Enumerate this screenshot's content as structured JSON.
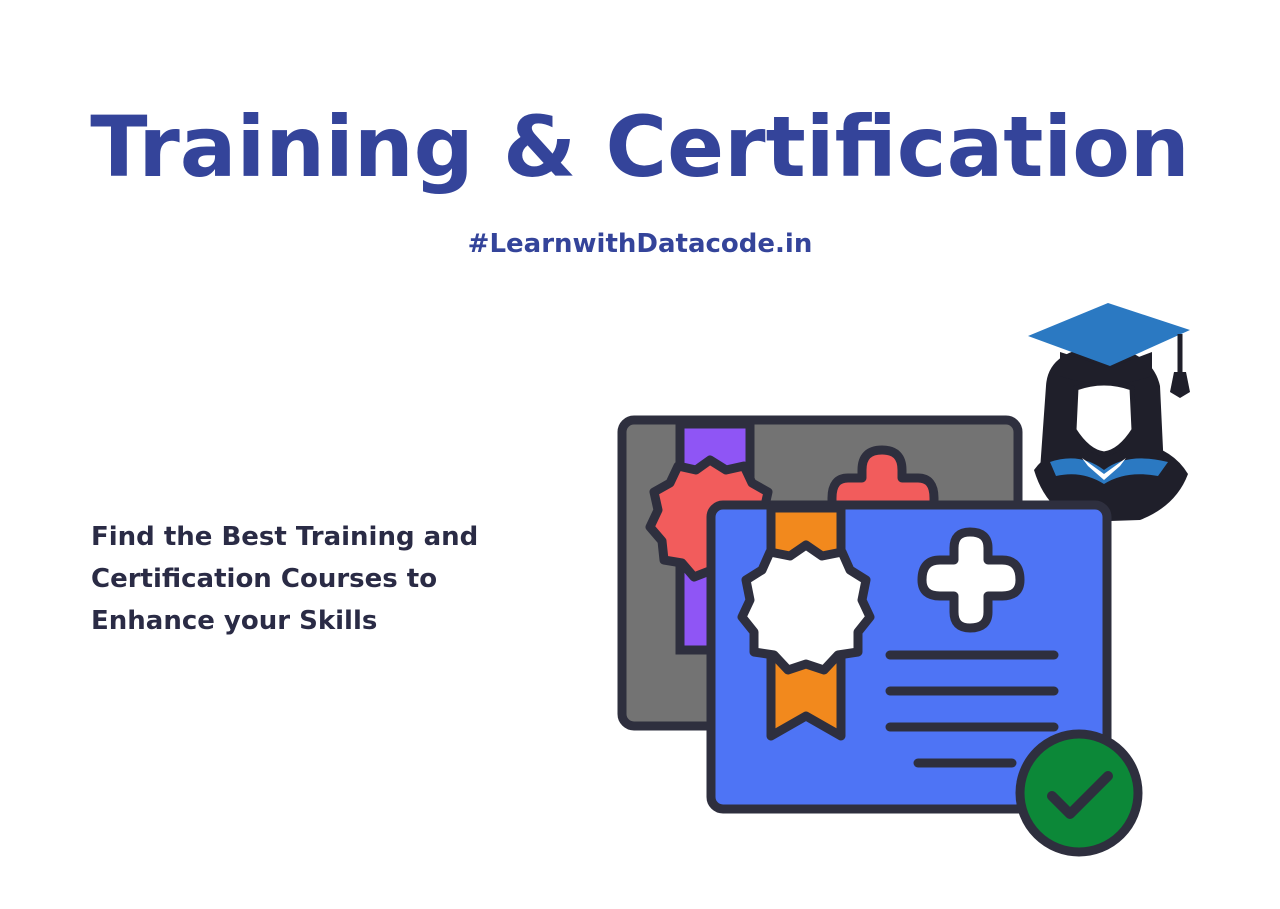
{
  "title": "Training & Certification",
  "hashtag": "#LearnwithDatacode.in",
  "tagline": "Find the Best Training and Certification Courses to Enhance your Skills",
  "colors": {
    "brand": "#34449a",
    "text": "#2a2b45",
    "outline": "#2e2f3e",
    "certificate_front": "#4e74f5",
    "certificate_back": "#737373",
    "ribbon_front": "#f2891d",
    "ribbon_back": "#8f55f5",
    "seal_back": "#f25c5c",
    "cap": "#2b79c2",
    "check_badge": "#0c8838"
  },
  "icons": [
    "certificate-icon",
    "graduate-icon",
    "check-badge-icon"
  ]
}
